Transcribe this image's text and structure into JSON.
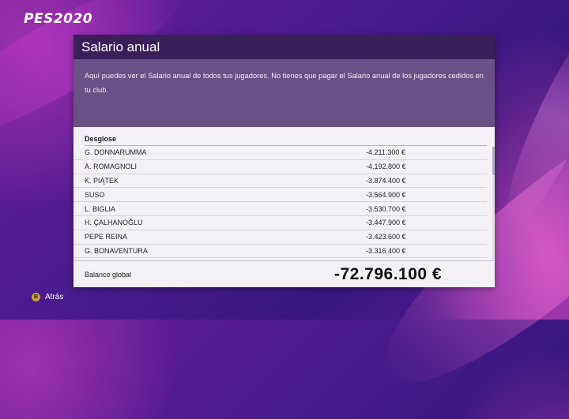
{
  "game": {
    "logo": "PES2020"
  },
  "panel": {
    "title": "Salario anual",
    "description": "Aquí puedes ver el Salario anual de todos tus jugadores. No tienes que pagar el Salario anual de los jugadores cedidos en tu club."
  },
  "breakdown": {
    "title": "Desglose",
    "rows": [
      {
        "name": "G. DONNARUMMA",
        "amount": "-4.211.300 €"
      },
      {
        "name": "A. ROMAGNOLI",
        "amount": "-4.192.800 €"
      },
      {
        "name": "K. PIĄTEK",
        "amount": "-3.874.400 €"
      },
      {
        "name": "SUSO",
        "amount": "-3.564.900 €"
      },
      {
        "name": "L. BIGLIA",
        "amount": "-3.530.700 €"
      },
      {
        "name": "H. ÇALHANOĞLU",
        "amount": "-3.447.900 €"
      },
      {
        "name": "PEPE REINA",
        "amount": "-3.423.600 €"
      },
      {
        "name": "G. BONAVENTURA",
        "amount": "-3.316.400 €"
      }
    ]
  },
  "total": {
    "label": "Balance global",
    "value": "-72.796.100 €"
  },
  "footer": {
    "back_button_glyph": "B",
    "back_label": "Atrás"
  },
  "colors": {
    "header": "#3b1f58",
    "description_bg": "#6a5084",
    "panel_bg": "#f3f1f6",
    "button_b": "#c9a23a"
  }
}
